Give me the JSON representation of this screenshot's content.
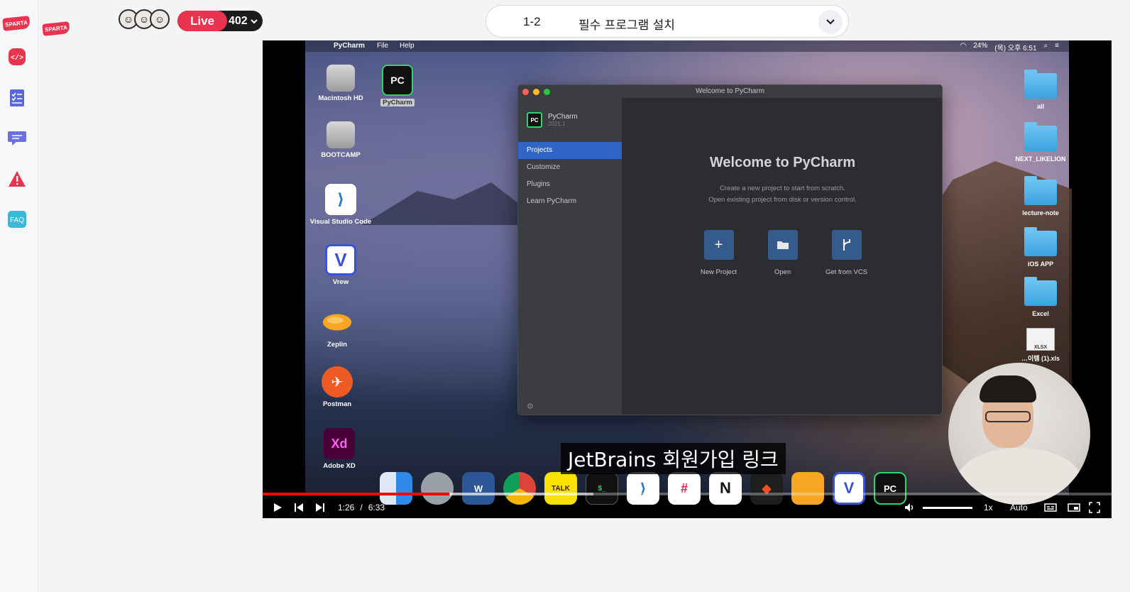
{
  "brand": {
    "logo_text": "SPARTA",
    "accent": "#e8344e"
  },
  "sidebar": {
    "items": [
      {
        "name": "code-icon",
        "color": "#e8344e"
      },
      {
        "name": "checklist-icon",
        "color": "#5a67d8"
      },
      {
        "name": "chat-icon",
        "color": "#6b72e0"
      },
      {
        "name": "warning-icon",
        "color": "#e8344e"
      },
      {
        "name": "faq-icon",
        "label": "FAQ",
        "color": "#3bb8d8"
      }
    ]
  },
  "header": {
    "live_label": "Live",
    "viewer_count": "402",
    "lesson_number": "1-2",
    "lesson_title": "필수 프로그램 설치"
  },
  "desktop": {
    "menubar": {
      "apple": "",
      "app": "PyCharm",
      "file": "File",
      "help": "Help",
      "battery": "24%",
      "clock": "(목) 오후 6:51"
    },
    "left_icons": [
      {
        "label": "Macintosh HD",
        "glyph": "▭"
      },
      {
        "label": "PyCharm",
        "glyph": "PC"
      },
      {
        "label": "BOOTCAMP",
        "glyph": "▭"
      },
      {
        "label": "Visual Studio Code",
        "glyph": "⟩"
      },
      {
        "label": "Vrew",
        "glyph": "V"
      },
      {
        "label": "Zeplin",
        "glyph": "◉"
      },
      {
        "label": "Postman",
        "glyph": "✈"
      },
      {
        "label": "Adobe XD",
        "glyph": "Xd"
      }
    ],
    "right_folders": [
      {
        "label": "all"
      },
      {
        "label": "NEXT_LIKELION"
      },
      {
        "label": "lecture-note"
      },
      {
        "label": "iOS APP"
      },
      {
        "label": "Excel"
      }
    ],
    "xlsx_label": "XLSX",
    "xlsx_name": "…이템 (1).xls"
  },
  "pycharm": {
    "window_title": "Welcome to PyCharm",
    "brand_name": "PyCharm",
    "brand_version": "2021.1",
    "nav": [
      "Projects",
      "Customize",
      "Plugins",
      "Learn PyCharm"
    ],
    "welcome": "Welcome to PyCharm",
    "desc_line1": "Create a new project to start from scratch.",
    "desc_line2": "Open existing project from disk or version control.",
    "actions": [
      {
        "label": "New Project",
        "glyph": "+"
      },
      {
        "label": "Open",
        "glyph": "▬"
      },
      {
        "label": "Get from VCS",
        "glyph": "ᚴ"
      }
    ]
  },
  "subtitle": "JetBrains 회원가입 링크",
  "player": {
    "current_time": "1:26",
    "separator": "/",
    "duration": "6:33",
    "played_fraction": 0.22,
    "buffered_fraction": 0.39,
    "volume_fraction": 1.0,
    "speed": "1x",
    "quality": "Auto"
  }
}
